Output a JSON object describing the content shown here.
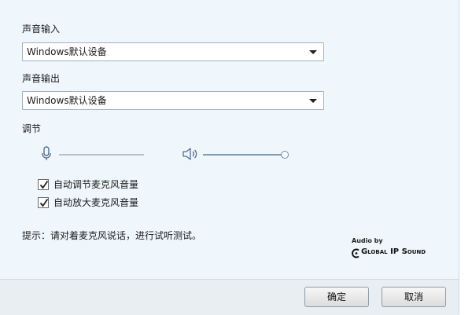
{
  "input": {
    "label": "声音输入",
    "selected": "Windows默认设备"
  },
  "output": {
    "label": "声音输出",
    "selected": "Windows默认设备"
  },
  "adjust": {
    "label": "调节",
    "mic_level": 0.0,
    "speaker_level": 1.0
  },
  "options": [
    {
      "label": "自动调节麦克风音量",
      "checked": true
    },
    {
      "label": "自动放大麦克风音量",
      "checked": true
    }
  ],
  "hint": "提示：请对着麦克风说话，进行试听测试。",
  "logo": {
    "audio_by": "Audio by",
    "brand": "Global IP Sound"
  },
  "buttons": {
    "ok": "确定",
    "cancel": "取消"
  }
}
